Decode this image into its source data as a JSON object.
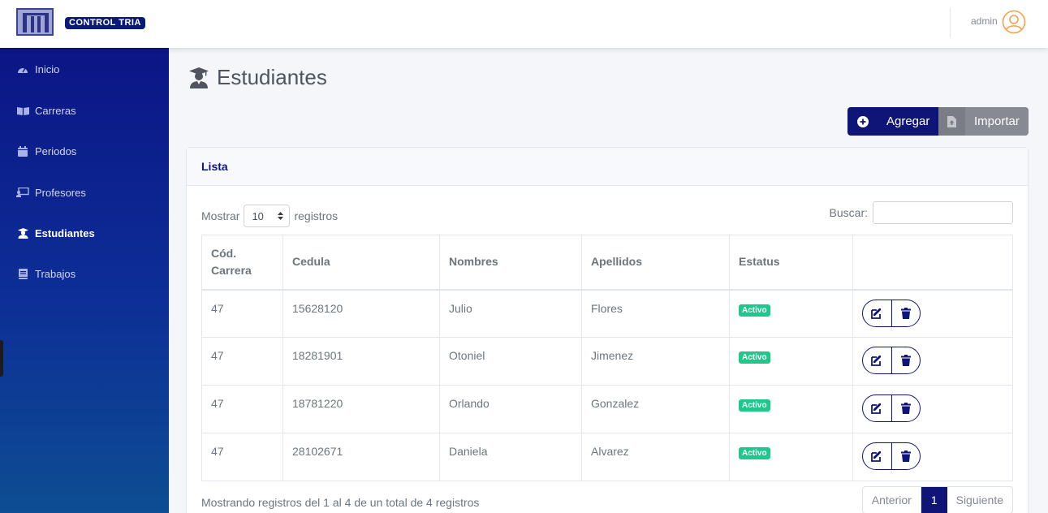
{
  "brand": {
    "name": "CONTROL TRIA"
  },
  "user": {
    "name": "admin"
  },
  "sidebar": {
    "items": [
      {
        "label": "Inicio",
        "icon": "dashboard-icon",
        "active": false
      },
      {
        "label": "Carreras",
        "icon": "book-open-icon",
        "active": false
      },
      {
        "label": "Periodos",
        "icon": "calendar-icon",
        "active": false
      },
      {
        "label": "Profesores",
        "icon": "chalkboard-teacher-icon",
        "active": false
      },
      {
        "label": "Estudiantes",
        "icon": "user-graduate-icon",
        "active": true
      },
      {
        "label": "Trabajos",
        "icon": "book-icon",
        "active": false
      }
    ]
  },
  "page": {
    "title": "Estudiantes",
    "icon": "user-graduate-icon"
  },
  "actions": {
    "add_label": "Agregar",
    "import_label": "Importar"
  },
  "card": {
    "title": "Lista"
  },
  "table_controls": {
    "show_label": "Mostrar",
    "page_size": "10",
    "records_label": "registros",
    "search_label": "Buscar:",
    "search_value": ""
  },
  "table": {
    "headers": {
      "code_line1": "Cód.",
      "code_line2": "Carrera",
      "cedula": "Cedula",
      "nombres": "Nombres",
      "apellidos": "Apellidos",
      "estatus": "Estatus"
    },
    "rows": [
      {
        "code": "47",
        "cedula": "15628120",
        "nombres": "Julio",
        "apellidos": "Flores",
        "estatus": "Activo"
      },
      {
        "code": "47",
        "cedula": "18281901",
        "nombres": "Otoniel",
        "apellidos": "Jimenez",
        "estatus": "Activo"
      },
      {
        "code": "47",
        "cedula": "18781220",
        "nombres": "Orlando",
        "apellidos": "Gonzalez",
        "estatus": "Activo"
      },
      {
        "code": "47",
        "cedula": "28102671",
        "nombres": "Daniela",
        "apellidos": "Alvarez",
        "estatus": "Activo"
      }
    ]
  },
  "footer": {
    "info": "Mostrando registros del 1 al 4 de un total de 4 registros",
    "prev_label": "Anterior",
    "current_page": "1",
    "next_label": "Siguiente"
  },
  "colors": {
    "primary": "#0f1577",
    "success": "#1cc88a",
    "secondary": "#878a92",
    "sidebar_top": "#0c1585",
    "sidebar_bottom": "#0d4d92"
  }
}
